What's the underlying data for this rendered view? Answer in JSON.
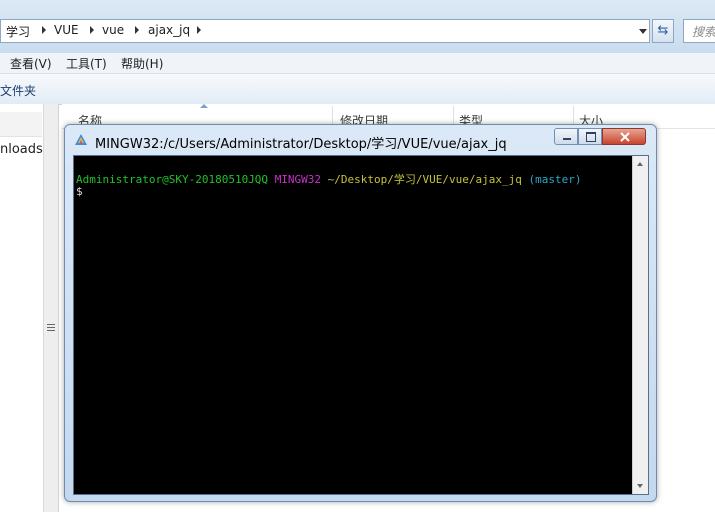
{
  "explorer": {
    "breadcrumb": [
      "学习",
      "VUE",
      "vue",
      "ajax_jq"
    ],
    "search_placeholder": "搜索",
    "menu": [
      "查看(V)",
      "工具(T)",
      "帮助(H)"
    ],
    "toolbar_label": "文件夹",
    "nav_label": "nloads",
    "columns": [
      "名称",
      "修改日期",
      "类型",
      "大小"
    ]
  },
  "terminal": {
    "title": "MINGW32:/c/Users/Administrator/Desktop/学习/VUE/vue/ajax_jq",
    "prompt_user": "Administrator@SKY-20180510JQQ",
    "prompt_env": "MINGW32",
    "prompt_path": "~/Desktop/学习/VUE/vue/ajax_jq",
    "prompt_branch": "(master)",
    "cursor_line": "$"
  },
  "colors": {
    "user": "#22c22b",
    "env": "#c832c8",
    "path": "#c7c23a",
    "branch": "#2aa8c8"
  }
}
